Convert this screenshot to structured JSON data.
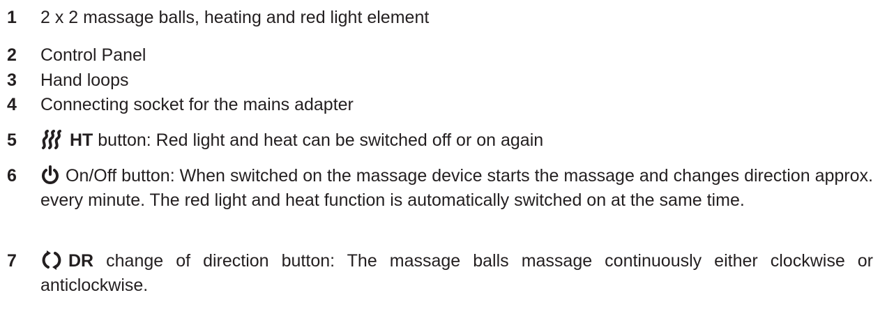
{
  "items": [
    {
      "number": "1",
      "text": "2 x 2 massage balls, heating and red light element"
    },
    {
      "number": "2",
      "text": "Control Panel"
    },
    {
      "number": "3",
      "text": "Hand loops"
    },
    {
      "number": "4",
      "text": "Connecting socket for the mains adapter"
    },
    {
      "number": "5",
      "icon": "heat-waves-icon",
      "keyword": "HT",
      "text": " button: Red light and heat can be switched off or on again"
    },
    {
      "number": "6",
      "icon": "power-icon",
      "text": "On/Off button: When switched on the massage device starts the massage and changes direction approx. every minute. The red light and heat function is automatically switched on at the same time."
    },
    {
      "number": "7",
      "icon": "direction-change-icon",
      "keyword": "DR",
      "text": " change of direction button: The massage balls massage continuously either clockwise or anticlockwise."
    }
  ],
  "colors": {
    "text": "#231f20"
  }
}
